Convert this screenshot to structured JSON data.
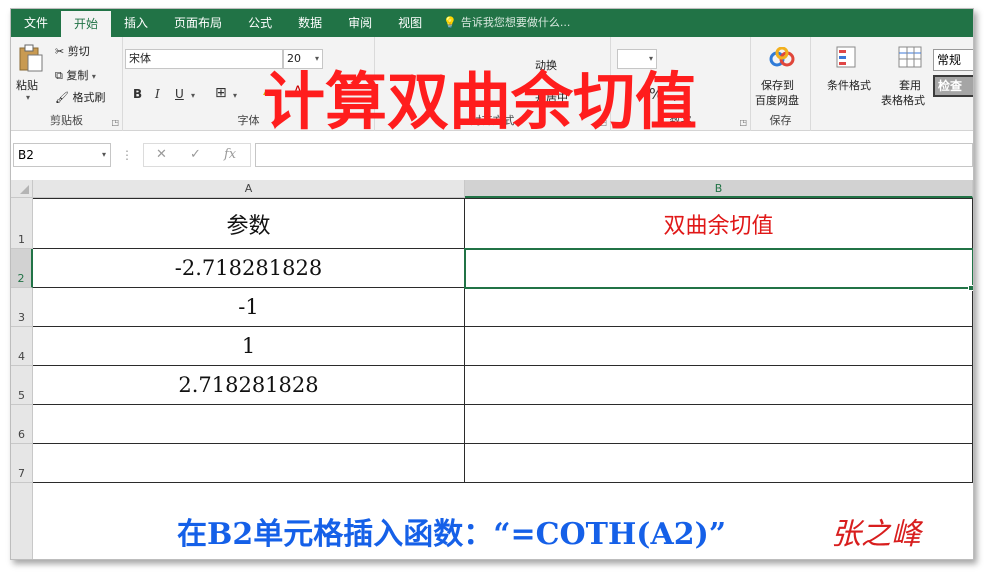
{
  "ribbon_tabs": [
    "文件",
    "开始",
    "插入",
    "页面布局",
    "公式",
    "数据",
    "审阅",
    "视图"
  ],
  "active_tab": "开始",
  "tell_me": "告诉我您想要做什么...",
  "clipboard": {
    "paste": "粘贴",
    "cut": "剪切",
    "copy": "复制",
    "format_painter": "格式刷",
    "label": "剪贴板"
  },
  "font": {
    "name": "宋体",
    "size": "20",
    "bold": "B",
    "italic": "I",
    "underline": "U",
    "label": "字体"
  },
  "alignment": {
    "merge": "并居中",
    "wrap": "动换",
    "label": "对齐方式"
  },
  "number": {
    "percent": "%",
    "comma": ",",
    "label": "数字"
  },
  "save": {
    "save_to": "保存到",
    "baidu": "百度网盘",
    "label": "保存"
  },
  "styles": {
    "conditional": "条件格式",
    "table_apply_1": "套用",
    "table_apply_2": "表格格式",
    "normal": "常规",
    "check": "检查"
  },
  "overlay_title": "计算双曲余切值",
  "formula_bar": {
    "name_box": "B2",
    "value": ""
  },
  "grid": {
    "columns": [
      "A",
      "B"
    ],
    "rows": [
      "1",
      "2",
      "3",
      "4",
      "5",
      "6",
      "7"
    ],
    "header_row": {
      "a": "参数",
      "b": "双曲余切值"
    },
    "values": [
      "-2.718281828",
      "-1",
      "1",
      "2.718281828",
      "",
      ""
    ]
  },
  "caption": "在B2单元格插入函数：“=COTH(A2)”",
  "signature": "张之峰",
  "colors": {
    "excel_green": "#217346",
    "title_red": "#ff1d1d",
    "caption_blue": "#1560e8"
  }
}
